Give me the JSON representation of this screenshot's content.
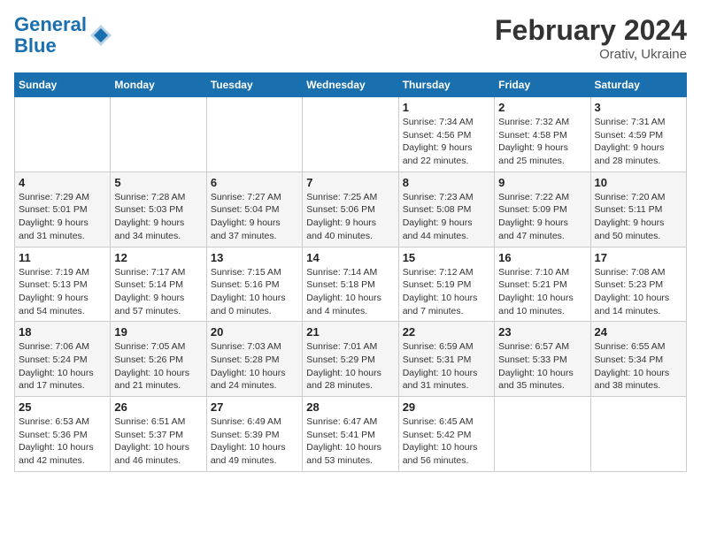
{
  "header": {
    "logo_line1": "General",
    "logo_line2": "Blue",
    "title": "February 2024",
    "subtitle": "Orativ, Ukraine"
  },
  "days_of_week": [
    "Sunday",
    "Monday",
    "Tuesday",
    "Wednesday",
    "Thursday",
    "Friday",
    "Saturday"
  ],
  "weeks": [
    [
      {
        "day": "",
        "info": ""
      },
      {
        "day": "",
        "info": ""
      },
      {
        "day": "",
        "info": ""
      },
      {
        "day": "",
        "info": ""
      },
      {
        "day": "1",
        "info": "Sunrise: 7:34 AM\nSunset: 4:56 PM\nDaylight: 9 hours\nand 22 minutes."
      },
      {
        "day": "2",
        "info": "Sunrise: 7:32 AM\nSunset: 4:58 PM\nDaylight: 9 hours\nand 25 minutes."
      },
      {
        "day": "3",
        "info": "Sunrise: 7:31 AM\nSunset: 4:59 PM\nDaylight: 9 hours\nand 28 minutes."
      }
    ],
    [
      {
        "day": "4",
        "info": "Sunrise: 7:29 AM\nSunset: 5:01 PM\nDaylight: 9 hours\nand 31 minutes."
      },
      {
        "day": "5",
        "info": "Sunrise: 7:28 AM\nSunset: 5:03 PM\nDaylight: 9 hours\nand 34 minutes."
      },
      {
        "day": "6",
        "info": "Sunrise: 7:27 AM\nSunset: 5:04 PM\nDaylight: 9 hours\nand 37 minutes."
      },
      {
        "day": "7",
        "info": "Sunrise: 7:25 AM\nSunset: 5:06 PM\nDaylight: 9 hours\nand 40 minutes."
      },
      {
        "day": "8",
        "info": "Sunrise: 7:23 AM\nSunset: 5:08 PM\nDaylight: 9 hours\nand 44 minutes."
      },
      {
        "day": "9",
        "info": "Sunrise: 7:22 AM\nSunset: 5:09 PM\nDaylight: 9 hours\nand 47 minutes."
      },
      {
        "day": "10",
        "info": "Sunrise: 7:20 AM\nSunset: 5:11 PM\nDaylight: 9 hours\nand 50 minutes."
      }
    ],
    [
      {
        "day": "11",
        "info": "Sunrise: 7:19 AM\nSunset: 5:13 PM\nDaylight: 9 hours\nand 54 minutes."
      },
      {
        "day": "12",
        "info": "Sunrise: 7:17 AM\nSunset: 5:14 PM\nDaylight: 9 hours\nand 57 minutes."
      },
      {
        "day": "13",
        "info": "Sunrise: 7:15 AM\nSunset: 5:16 PM\nDaylight: 10 hours\nand 0 minutes."
      },
      {
        "day": "14",
        "info": "Sunrise: 7:14 AM\nSunset: 5:18 PM\nDaylight: 10 hours\nand 4 minutes."
      },
      {
        "day": "15",
        "info": "Sunrise: 7:12 AM\nSunset: 5:19 PM\nDaylight: 10 hours\nand 7 minutes."
      },
      {
        "day": "16",
        "info": "Sunrise: 7:10 AM\nSunset: 5:21 PM\nDaylight: 10 hours\nand 10 minutes."
      },
      {
        "day": "17",
        "info": "Sunrise: 7:08 AM\nSunset: 5:23 PM\nDaylight: 10 hours\nand 14 minutes."
      }
    ],
    [
      {
        "day": "18",
        "info": "Sunrise: 7:06 AM\nSunset: 5:24 PM\nDaylight: 10 hours\nand 17 minutes."
      },
      {
        "day": "19",
        "info": "Sunrise: 7:05 AM\nSunset: 5:26 PM\nDaylight: 10 hours\nand 21 minutes."
      },
      {
        "day": "20",
        "info": "Sunrise: 7:03 AM\nSunset: 5:28 PM\nDaylight: 10 hours\nand 24 minutes."
      },
      {
        "day": "21",
        "info": "Sunrise: 7:01 AM\nSunset: 5:29 PM\nDaylight: 10 hours\nand 28 minutes."
      },
      {
        "day": "22",
        "info": "Sunrise: 6:59 AM\nSunset: 5:31 PM\nDaylight: 10 hours\nand 31 minutes."
      },
      {
        "day": "23",
        "info": "Sunrise: 6:57 AM\nSunset: 5:33 PM\nDaylight: 10 hours\nand 35 minutes."
      },
      {
        "day": "24",
        "info": "Sunrise: 6:55 AM\nSunset: 5:34 PM\nDaylight: 10 hours\nand 38 minutes."
      }
    ],
    [
      {
        "day": "25",
        "info": "Sunrise: 6:53 AM\nSunset: 5:36 PM\nDaylight: 10 hours\nand 42 minutes."
      },
      {
        "day": "26",
        "info": "Sunrise: 6:51 AM\nSunset: 5:37 PM\nDaylight: 10 hours\nand 46 minutes."
      },
      {
        "day": "27",
        "info": "Sunrise: 6:49 AM\nSunset: 5:39 PM\nDaylight: 10 hours\nand 49 minutes."
      },
      {
        "day": "28",
        "info": "Sunrise: 6:47 AM\nSunset: 5:41 PM\nDaylight: 10 hours\nand 53 minutes."
      },
      {
        "day": "29",
        "info": "Sunrise: 6:45 AM\nSunset: 5:42 PM\nDaylight: 10 hours\nand 56 minutes."
      },
      {
        "day": "",
        "info": ""
      },
      {
        "day": "",
        "info": ""
      }
    ]
  ]
}
